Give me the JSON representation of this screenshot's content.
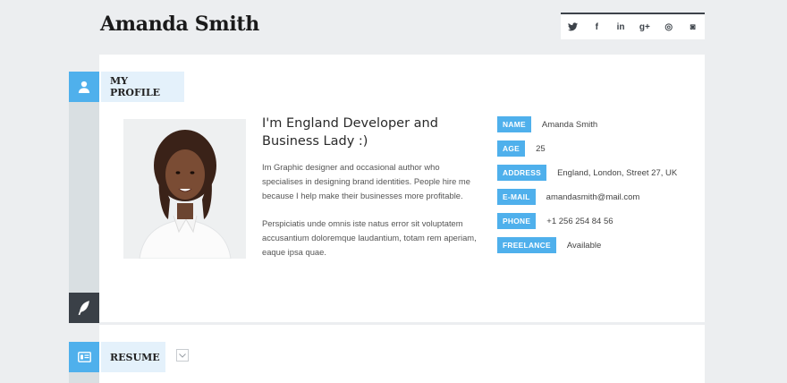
{
  "header": {
    "name": "Amanda Smith"
  },
  "social": [
    {
      "icon": "twitter-icon",
      "glyph": "t"
    },
    {
      "icon": "facebook-icon",
      "glyph": "f"
    },
    {
      "icon": "linkedin-icon",
      "glyph": "in"
    },
    {
      "icon": "google-plus-icon",
      "glyph": "g+"
    },
    {
      "icon": "dribbble-icon",
      "glyph": "◎"
    },
    {
      "icon": "instagram-icon",
      "glyph": "◙"
    }
  ],
  "profile": {
    "section_title": "MY PROFILE",
    "headline": "I'm England Developer and Business Lady :)",
    "paragraph1": "Im Graphic designer and occasional author who specialises in designing brand identities. People hire me because I help make their businesses more profitable.",
    "paragraph2": "Perspiciatis unde omnis iste natus error sit voluptatem accusantium doloremque laudantium, totam rem aperiam, eaque ipsa quae.",
    "info": [
      {
        "label": "NAME",
        "value": "Amanda Smith"
      },
      {
        "label": "AGE",
        "value": "25"
      },
      {
        "label": "ADDRESS",
        "value": "England, London, Street 27, UK"
      },
      {
        "label": "E-MAIL",
        "value": "amandasmith@mail.com"
      },
      {
        "label": "PHONE",
        "value": "+1 256 254 84 56"
      },
      {
        "label": "FREELANCE",
        "value": "Available"
      }
    ]
  },
  "resume": {
    "section_title": "RESUME"
  },
  "colors": {
    "accent": "#4fb0ec",
    "dark": "#3a4047",
    "rail": "#d9dfe2",
    "title_bg": "#e4f1fb"
  }
}
